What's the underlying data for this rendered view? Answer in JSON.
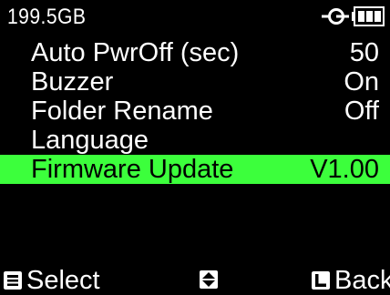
{
  "status": {
    "storage_text": "199.5GB",
    "power_icon": "power-plug-icon",
    "battery_icon": "battery-full-icon"
  },
  "menu": {
    "items": [
      {
        "label": "Auto PwrOff (sec)",
        "value": "50",
        "selected": false
      },
      {
        "label": "Buzzer",
        "value": "On",
        "selected": false
      },
      {
        "label": "Folder Rename",
        "value": "Off",
        "selected": false
      },
      {
        "label": "Language",
        "value": "",
        "selected": false
      },
      {
        "label": "Firmware Update",
        "value": "V1.00",
        "selected": true
      }
    ],
    "highlight_color": "#3cff3c"
  },
  "footer": {
    "select_label": "Select",
    "back_label": "Back",
    "select_icon": "menu-button-icon",
    "nav_icon": "up-down-arrows-icon",
    "back_icon": "l-button-icon"
  }
}
